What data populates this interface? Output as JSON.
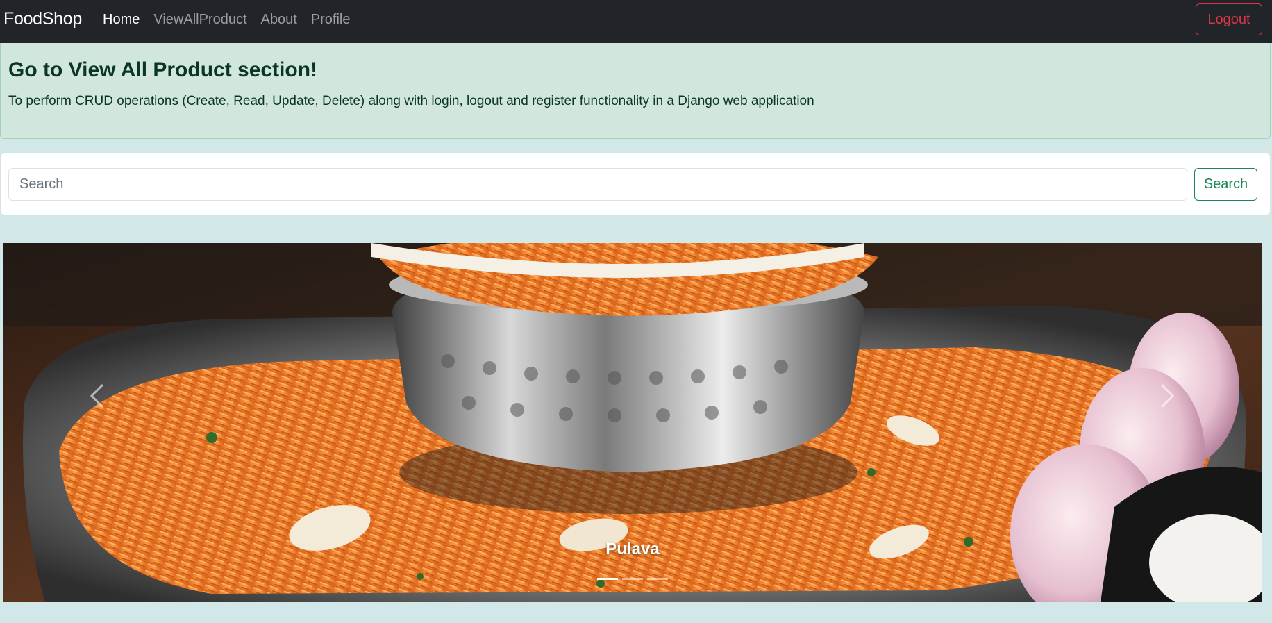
{
  "navbar": {
    "brand": "FoodShop",
    "links": [
      {
        "label": "Home",
        "active": true
      },
      {
        "label": "ViewAllProduct",
        "active": false
      },
      {
        "label": "About",
        "active": false
      },
      {
        "label": "Profile",
        "active": false
      }
    ],
    "logout_label": "Logout"
  },
  "alert": {
    "title": "Go to View All Product section!",
    "text": "To perform CRUD operations (Create, Read, Update, Delete) along with login, logout and register functionality in a Django web application"
  },
  "search": {
    "placeholder": "Search",
    "button_label": "Search"
  },
  "carousel": {
    "caption": "Pulava",
    "slide_count": 3,
    "active_slide": 1,
    "prev_icon": "chevron-left-icon",
    "next_icon": "chevron-right-icon"
  },
  "colors": {
    "navbar_bg": "#212529",
    "page_bg": "#d1e7e8",
    "alert_bg": "#d1e7dd",
    "alert_text": "#0a3622",
    "logout": "#dc3545",
    "search_btn": "#198754"
  }
}
